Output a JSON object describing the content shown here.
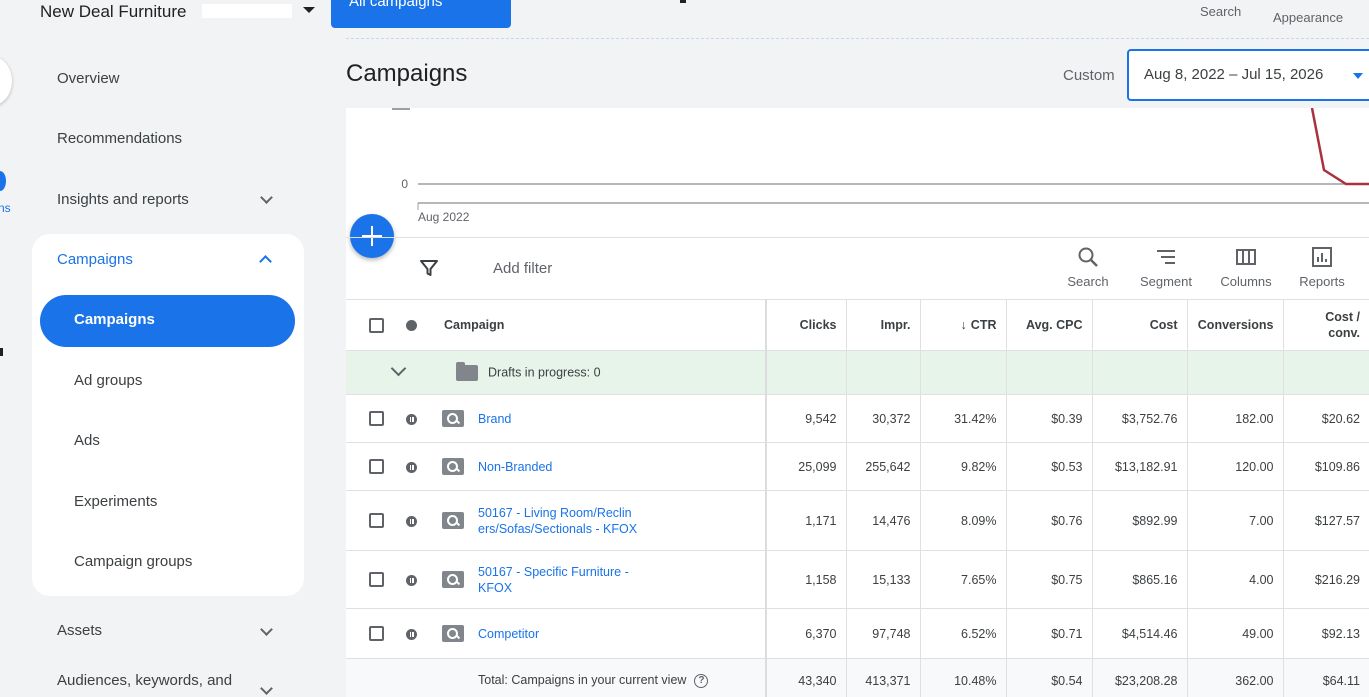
{
  "header": {
    "account_name": "New Deal Furniture",
    "all_campaigns_label": "All campaigns",
    "search_label": "Search",
    "appearance_label": "Appearance"
  },
  "rail": {
    "label": "ns"
  },
  "sidebar": {
    "overview": "Overview",
    "recommendations": "Recommendations",
    "insights": "Insights and reports",
    "campaigns_group": "Campaigns",
    "sub_items": [
      "Campaigns",
      "Ad groups",
      "Ads",
      "Experiments",
      "Campaign groups"
    ],
    "assets": "Assets",
    "audiences": "Audiences, keywords, and"
  },
  "page": {
    "title": "Campaigns",
    "date_mode": "Custom",
    "date_range": "Aug 8, 2022 – Jul 15, 2026"
  },
  "chart_data": {
    "type": "line",
    "y_tick_labels": [
      "0"
    ],
    "x_tick_labels": [
      "Aug 2022"
    ],
    "series_color": "#a8323e"
  },
  "toolbar": {
    "add_filter": "Add filter",
    "search": "Search",
    "segment": "Segment",
    "columns": "Columns",
    "reports": "Reports"
  },
  "table": {
    "headers": {
      "campaign": "Campaign",
      "clicks": "Clicks",
      "impr": "Impr.",
      "ctr": "CTR",
      "avg_cpc": "Avg. CPC",
      "cost": "Cost",
      "conversions": "Conversions",
      "cost_conv_1": "Cost /",
      "cost_conv_2": "conv."
    },
    "drafts": "Drafts in progress: 0",
    "rows": [
      {
        "name": "Brand",
        "clicks": "9,542",
        "impr": "30,372",
        "ctr": "31.42%",
        "avg_cpc": "$0.39",
        "cost": "$3,752.76",
        "conversions": "182.00",
        "cost_conv": "$20.62"
      },
      {
        "name": "Non-Branded",
        "clicks": "25,099",
        "impr": "255,642",
        "ctr": "9.82%",
        "avg_cpc": "$0.53",
        "cost": "$13,182.91",
        "conversions": "120.00",
        "cost_conv": "$109.86"
      },
      {
        "name": "50167 - Living Room/Recliners/Sofas/Sectionals - KFOX",
        "clicks": "1,171",
        "impr": "14,476",
        "ctr": "8.09%",
        "avg_cpc": "$0.76",
        "cost": "$892.99",
        "conversions": "7.00",
        "cost_conv": "$127.57"
      },
      {
        "name": "50167 - Specific Furniture - KFOX",
        "clicks": "1,158",
        "impr": "15,133",
        "ctr": "7.65%",
        "avg_cpc": "$0.75",
        "cost": "$865.16",
        "conversions": "4.00",
        "cost_conv": "$216.29"
      },
      {
        "name": "Competitor",
        "clicks": "6,370",
        "impr": "97,748",
        "ctr": "6.52%",
        "avg_cpc": "$0.71",
        "cost": "$4,514.46",
        "conversions": "49.00",
        "cost_conv": "$92.13"
      }
    ],
    "total": {
      "label": "Total: Campaigns in your current view",
      "help": "?",
      "clicks": "43,340",
      "impr": "413,371",
      "ctr": "10.48%",
      "avg_cpc": "$0.54",
      "cost": "$23,208.28",
      "conversions": "362.00",
      "cost_conv": "$64.11"
    }
  }
}
